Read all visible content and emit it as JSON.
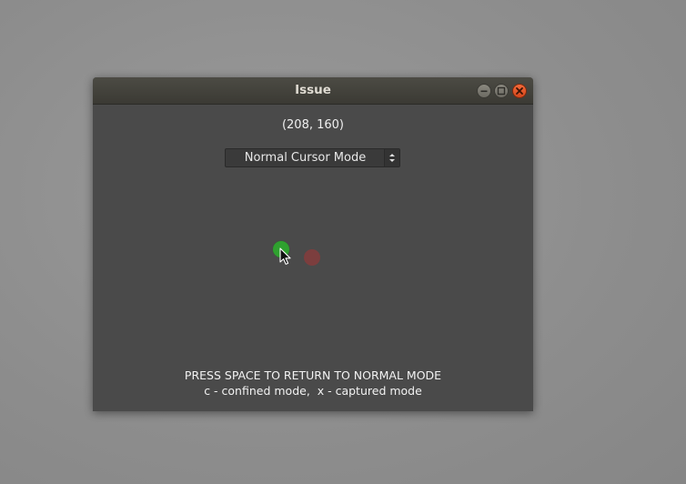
{
  "window": {
    "title": "Issue"
  },
  "main": {
    "cursor_position": "(208, 160)",
    "mode_select": {
      "selected": "Normal Cursor Mode"
    },
    "instructions": {
      "line1": "PRESS SPACE TO RETURN TO NORMAL MODE",
      "line2": "c - confined mode,  x - captured mode"
    }
  },
  "colors": {
    "window_bg": "#4a4a4a",
    "close_button": "#e05a2a",
    "green_dot": "#2fa12f",
    "red_dot": "#7c3e3e"
  },
  "icons": {
    "minimize": "minimize-icon",
    "maximize": "maximize-icon",
    "close": "close-icon",
    "select_arrows": "updown-arrows-icon",
    "cursor": "mouse-pointer-icon"
  }
}
